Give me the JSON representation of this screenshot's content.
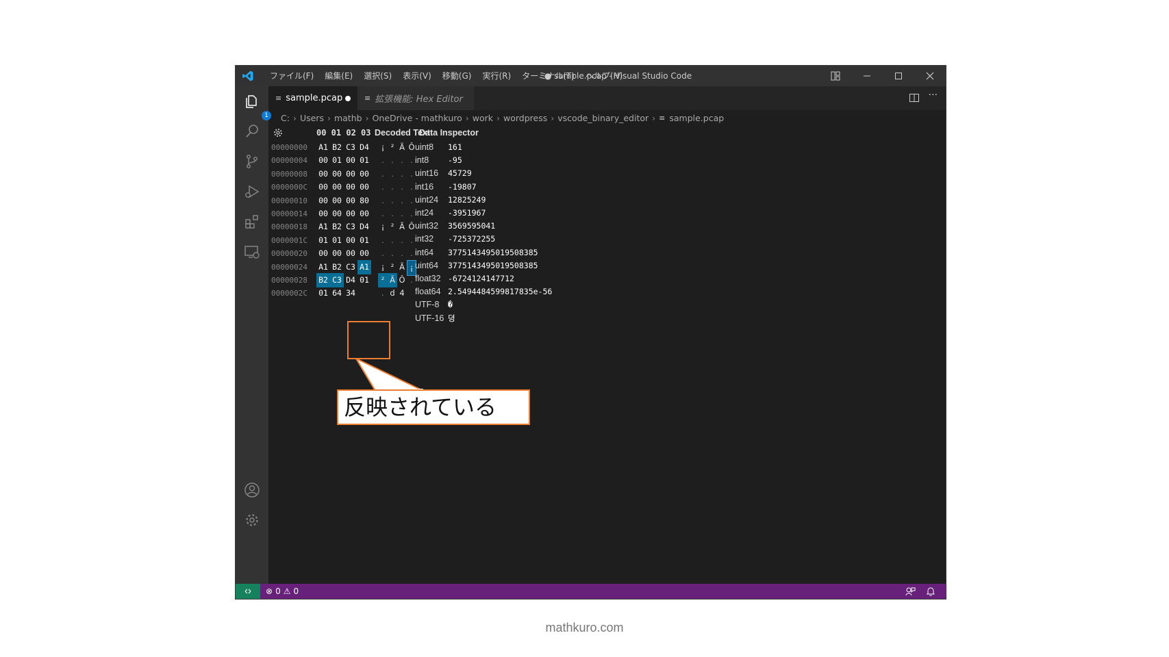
{
  "window": {
    "title": "● sample.pcap - Visual Studio Code",
    "menus": [
      "ファイル(F)",
      "編集(E)",
      "選択(S)",
      "表示(V)",
      "移動(G)",
      "実行(R)",
      "ターミナル(T)",
      "ヘルプ(H)"
    ]
  },
  "activity": {
    "explorer_badge": "1"
  },
  "tabs": [
    {
      "label": "sample.pcap",
      "modified": true
    },
    {
      "label": "拡張機能: Hex Editor"
    }
  ],
  "breadcrumbs": [
    "C:",
    "Users",
    "mathb",
    "OneDrive - mathkuro",
    "work",
    "wordpress",
    "vscode_binary_editor",
    "sample.pcap"
  ],
  "hex": {
    "column_header": "00 01 02 03",
    "decoded_header": "Decoded Text",
    "inspector_header": "Data Inspector",
    "rows": [
      {
        "addr": "00000000",
        "bytes": [
          "A1",
          "B2",
          "C3",
          "D4"
        ],
        "chars": [
          "¡",
          "²",
          "Ã",
          "Ô"
        ]
      },
      {
        "addr": "00000004",
        "bytes": [
          "00",
          "01",
          "00",
          "01"
        ],
        "chars": [
          ".",
          ".",
          ".",
          "."
        ]
      },
      {
        "addr": "00000008",
        "bytes": [
          "00",
          "00",
          "00",
          "00"
        ],
        "chars": [
          ".",
          ".",
          ".",
          "."
        ]
      },
      {
        "addr": "0000000C",
        "bytes": [
          "00",
          "00",
          "00",
          "00"
        ],
        "chars": [
          ".",
          ".",
          ".",
          "."
        ]
      },
      {
        "addr": "00000010",
        "bytes": [
          "00",
          "00",
          "00",
          "80"
        ],
        "chars": [
          ".",
          ".",
          ".",
          "."
        ]
      },
      {
        "addr": "00000014",
        "bytes": [
          "00",
          "00",
          "00",
          "00"
        ],
        "chars": [
          ".",
          ".",
          ".",
          "."
        ]
      },
      {
        "addr": "00000018",
        "bytes": [
          "A1",
          "B2",
          "C3",
          "D4"
        ],
        "chars": [
          "¡",
          "²",
          "Ã",
          "Ô"
        ]
      },
      {
        "addr": "0000001C",
        "bytes": [
          "01",
          "01",
          "00",
          "01"
        ],
        "chars": [
          ".",
          ".",
          ".",
          "."
        ]
      },
      {
        "addr": "00000020",
        "bytes": [
          "00",
          "00",
          "00",
          "00"
        ],
        "chars": [
          ".",
          ".",
          ".",
          "."
        ]
      },
      {
        "addr": "00000024",
        "bytes": [
          "A1",
          "B2",
          "C3",
          "A1"
        ],
        "chars": [
          "¡",
          "²",
          "Ã",
          "¡"
        ]
      },
      {
        "addr": "00000028",
        "bytes": [
          "B2",
          "C3",
          "D4",
          "01"
        ],
        "chars": [
          "²",
          "Ã",
          "Ô",
          "."
        ]
      },
      {
        "addr": "0000002C",
        "bytes": [
          "01",
          "64",
          "34"
        ],
        "chars": [
          ".",
          "d",
          "4"
        ]
      }
    ],
    "selected": [
      [
        9,
        3
      ],
      [
        10,
        0
      ],
      [
        10,
        1
      ]
    ]
  },
  "inspector": [
    {
      "label": "uint8",
      "value": "161"
    },
    {
      "label": "int8",
      "value": "-95"
    },
    {
      "label": "uint16",
      "value": "45729"
    },
    {
      "label": "int16",
      "value": "-19807"
    },
    {
      "label": "uint24",
      "value": "12825249"
    },
    {
      "label": "int24",
      "value": "-3951967"
    },
    {
      "label": "uint32",
      "value": "3569595041"
    },
    {
      "label": "int32",
      "value": "-725372255"
    },
    {
      "label": "int64",
      "value": "3775143495019508385"
    },
    {
      "label": "uint64",
      "value": "3775143495019508385"
    },
    {
      "label": "float32",
      "value": "-6724124147712"
    },
    {
      "label": "float64",
      "value": "2.5494484599817835e-56"
    },
    {
      "label": "UTF-8",
      "value": "�"
    },
    {
      "label": "UTF-16",
      "value": "뎡"
    }
  ],
  "callout": {
    "text": "反映されている",
    "color": "#ed7d31"
  },
  "status": {
    "errors": "0",
    "warnings": "0"
  },
  "watermark": "mathkuro.com"
}
